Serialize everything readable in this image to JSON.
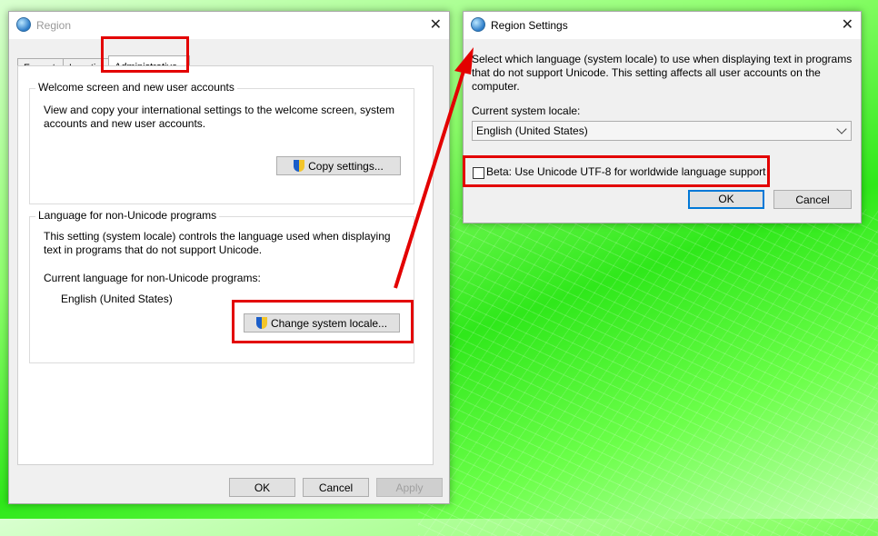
{
  "region": {
    "title": "Region",
    "tabs": [
      "Formats",
      "Location",
      "Administrative"
    ],
    "welcome_group": {
      "label": "Welcome screen and new user accounts",
      "text": "View and copy your international settings to the welcome screen, system accounts and new user accounts.",
      "button": "Copy settings..."
    },
    "nonunicode_group": {
      "label": "Language for non-Unicode programs",
      "text": "This setting (system locale) controls the language used when displaying text in programs that do not support Unicode.",
      "current_label": "Current language for non-Unicode programs:",
      "current_value": "English (United States)",
      "button": "Change system locale..."
    },
    "footer": {
      "ok": "OK",
      "cancel": "Cancel",
      "apply": "Apply"
    }
  },
  "region_settings": {
    "title": "Region Settings",
    "description": "Select which language (system locale) to use when displaying text in programs that do not support Unicode. This setting affects all user accounts on the computer.",
    "locale_label": "Current system locale:",
    "locale_value": "English (United States)",
    "beta_label": "Beta: Use Unicode UTF-8 for worldwide language support",
    "ok": "OK",
    "cancel": "Cancel"
  },
  "colors": {
    "highlight": "#e30000",
    "accent": "#0078d7"
  },
  "icons": [
    "globe-icon",
    "close-icon",
    "shield-icon",
    "chevron-down-icon",
    "arrow"
  ]
}
